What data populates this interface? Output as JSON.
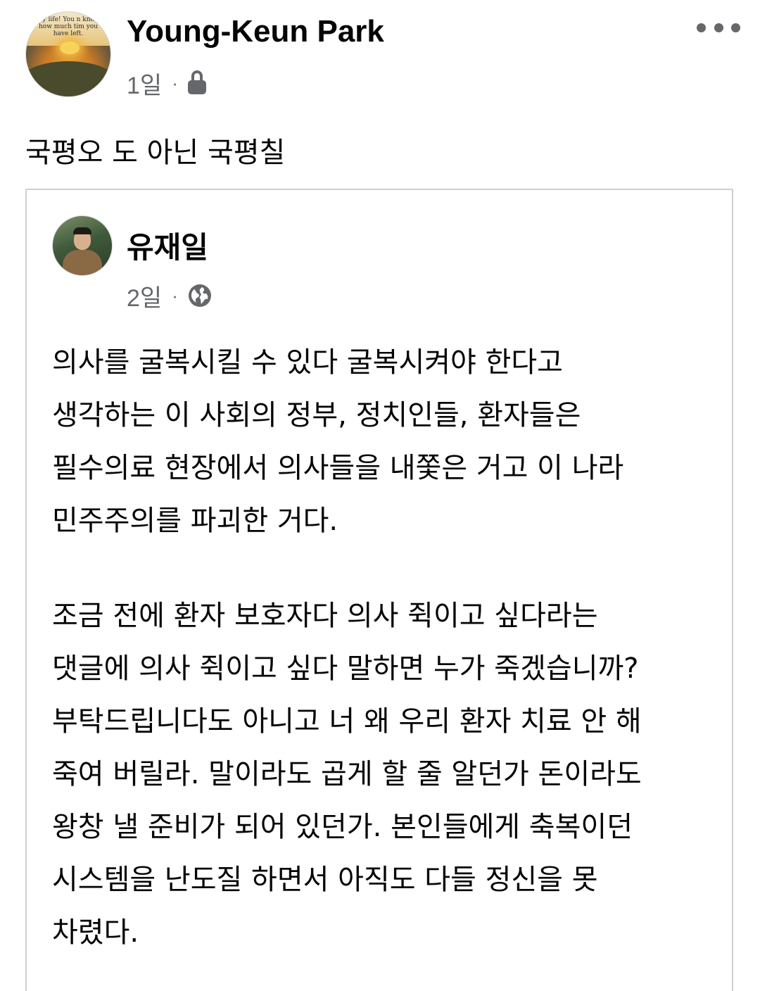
{
  "post": {
    "author": "Young-Keun Park",
    "time": "1일",
    "separator": "·",
    "privacy_icon": "lock-icon",
    "more_icon": "more-horizontal-icon",
    "text": "국평오 도 아닌 국평칠",
    "avatar_quote": "joy life! You n know how much tim you have left."
  },
  "shared_post": {
    "author": "유재일",
    "time": "2일",
    "separator": "·",
    "privacy_icon": "globe-icon",
    "paragraphs": [
      {
        "lines": [
          "의사를 굴복시킬 수 있다 굴복시켜야 한다고",
          "생각하는 이 사회의 정부, 정치인들, 환자들은",
          "필수의료 현장에서 의사들을 내쫓은 거고 이 나라",
          "민주주의를 파괴한 거다."
        ]
      },
      {
        "lines": [
          "조금 전에 환자 보호자다 의사 쥑이고 싶다라는",
          "댓글에 의사 쥑이고 싶다 말하면 누가 죽겠습니까?",
          "부탁드립니다도 아니고 너 왜 우리 환자 치료 안 해",
          "죽여 버릴라. 말이라도 곱게 할 줄 알던가 돈이라도",
          "왕창 낼 준비가 되어 있던가. 본인들에게 축복이던",
          "시스템을 난도질 하면서 아직도 다들 정신을 못",
          "차렸다."
        ]
      }
    ]
  },
  "colors": {
    "text_primary": "#050505",
    "text_secondary": "#65676b",
    "card_border": "#ced0d4"
  }
}
